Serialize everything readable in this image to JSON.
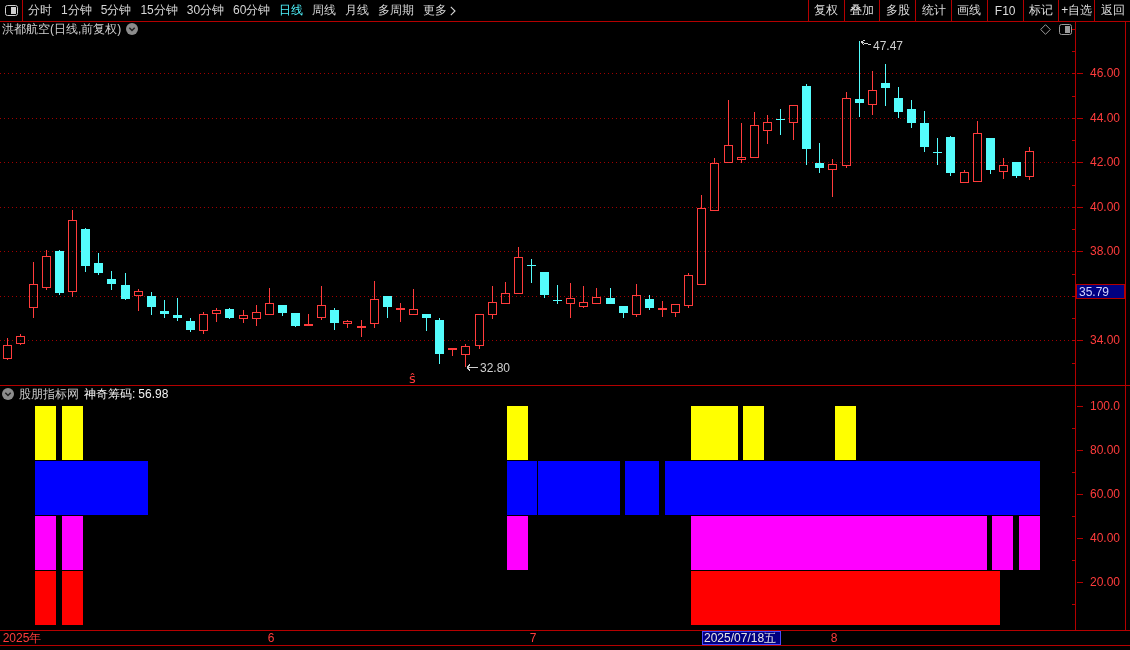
{
  "toolbar": {
    "periods": [
      {
        "label": "分时",
        "selected": false
      },
      {
        "label": "1分钟",
        "selected": false
      },
      {
        "label": "5分钟",
        "selected": false
      },
      {
        "label": "15分钟",
        "selected": false
      },
      {
        "label": "30分钟",
        "selected": false
      },
      {
        "label": "60分钟",
        "selected": false
      },
      {
        "label": "日线",
        "selected": true
      },
      {
        "label": "周线",
        "selected": false
      },
      {
        "label": "月线",
        "selected": false
      },
      {
        "label": "多周期",
        "selected": false
      },
      {
        "label": "更多",
        "selected": false
      }
    ],
    "actions": [
      "复权",
      "叠加",
      "多股",
      "统计",
      "画线",
      "F10",
      "标记",
      "+自选",
      "返回"
    ]
  },
  "price_pane": {
    "title": "洪都航空(日线,前复权)",
    "price_tag": "35.79",
    "signal_mark": "ŝ",
    "chart_data": [
      {
        "type": "candlestick",
        "ylim": [
          32,
          48.31
        ],
        "yticks": [
          {
            "value": 34,
            "label": "34.00"
          },
          {
            "value": 38,
            "label": "38.00"
          },
          {
            "value": 40,
            "label": "40.00"
          },
          {
            "value": 42,
            "label": "42.00"
          },
          {
            "value": 44,
            "label": "44.00"
          },
          {
            "value": 46,
            "label": "46.00"
          }
        ],
        "tick_labels": "y",
        "grid": true,
        "annotations": [
          "47.47",
          "32.80"
        ],
        "categories": [
          null,
          null,
          null,
          null,
          null,
          null,
          null,
          null,
          null,
          null,
          null,
          null,
          null,
          null,
          null,
          null,
          null,
          null,
          null,
          null,
          null,
          null,
          null,
          null,
          null,
          null,
          null,
          null,
          null,
          null,
          null,
          null,
          null,
          null,
          null,
          null,
          null,
          null,
          null,
          null,
          null,
          null,
          null,
          null,
          null,
          null,
          null,
          null,
          null,
          null,
          null,
          null,
          null,
          null,
          null,
          null,
          null,
          null,
          null,
          null,
          null,
          null,
          null,
          null,
          null,
          null,
          null,
          null,
          null,
          null,
          null,
          null,
          null,
          null,
          null,
          null,
          null,
          null,
          null,
          null,
          null,
          null
        ],
        "ohlc": [
          [
            33.22,
            34.11,
            33.13,
            33.8
          ],
          [
            33.89,
            34.3,
            33.8,
            34.2
          ],
          [
            35.51,
            37.53,
            35.01,
            36.54
          ],
          [
            36.41,
            38.07,
            36.27,
            37.8
          ],
          [
            38.03,
            38.07,
            36.05,
            36.14
          ],
          [
            36.23,
            39.87,
            35.96,
            39.42
          ],
          [
            39.02,
            39.06,
            37.08,
            37.35
          ],
          [
            37.49,
            37.94,
            36.95,
            37.04
          ],
          [
            36.77,
            37.13,
            36.27,
            36.54
          ],
          [
            36.5,
            37.04,
            35.82,
            35.87
          ],
          [
            36.05,
            36.32,
            35.33,
            36.23
          ],
          [
            36.0,
            36.18,
            35.15,
            35.51
          ],
          [
            35.33,
            35.82,
            35.01,
            35.19
          ],
          [
            35.15,
            35.91,
            34.88,
            35.01
          ],
          [
            34.88,
            35.01,
            34.38,
            34.47
          ],
          [
            34.47,
            35.28,
            34.29,
            35.19
          ],
          [
            35.24,
            35.46,
            34.83,
            35.37
          ],
          [
            35.42,
            35.46,
            34.97,
            35.01
          ],
          [
            35.01,
            35.37,
            34.79,
            35.15
          ],
          [
            35.01,
            35.6,
            34.65,
            35.28
          ],
          [
            35.19,
            36.36,
            35.19,
            35.69
          ],
          [
            35.6,
            35.6,
            35.1,
            35.24
          ],
          [
            35.24,
            35.24,
            34.61,
            34.65
          ],
          [
            34.74,
            35.19,
            34.74,
            34.76
          ],
          [
            35.06,
            36.45,
            34.92,
            35.6
          ],
          [
            35.37,
            35.46,
            34.47,
            34.79
          ],
          [
            34.79,
            34.92,
            34.56,
            34.88
          ],
          [
            34.61,
            34.92,
            34.16,
            34.65
          ],
          [
            34.79,
            36.68,
            34.56,
            35.87
          ],
          [
            36.0,
            36.0,
            35.01,
            35.51
          ],
          [
            35.46,
            35.69,
            34.83,
            35.48
          ],
          [
            35.19,
            36.32,
            35.19,
            35.42
          ],
          [
            35.19,
            35.19,
            34.43,
            35.01
          ],
          [
            34.92,
            35.01,
            32.95,
            33.4
          ],
          [
            33.62,
            33.66,
            33.3,
            33.66
          ],
          [
            33.4,
            33.84,
            32.8,
            33.75
          ],
          [
            33.8,
            35.19,
            33.62,
            35.19
          ],
          [
            35.19,
            36.45,
            34.97,
            35.73
          ],
          [
            35.69,
            36.63,
            35.69,
            36.14
          ],
          [
            36.14,
            38.21,
            36.14,
            37.76
          ],
          [
            37.4,
            37.67,
            36.59,
            37.35
          ],
          [
            37.08,
            37.08,
            35.91,
            36.05
          ],
          [
            35.82,
            36.5,
            35.64,
            35.78
          ],
          [
            35.69,
            36.59,
            35.01,
            35.91
          ],
          [
            35.55,
            36.45,
            35.46,
            35.73
          ],
          [
            35.69,
            36.36,
            35.69,
            35.96
          ],
          [
            35.91,
            36.36,
            35.64,
            35.64
          ],
          [
            35.55,
            35.55,
            35.01,
            35.24
          ],
          [
            35.19,
            36.54,
            35.06,
            36.05
          ],
          [
            35.87,
            36.05,
            35.37,
            35.46
          ],
          [
            35.46,
            35.78,
            35.06,
            35.48
          ],
          [
            35.28,
            35.64,
            35.06,
            35.64
          ],
          [
            35.6,
            37.04,
            35.46,
            36.95
          ],
          [
            36.54,
            40.55,
            36.5,
            39.96
          ],
          [
            39.87,
            42.21,
            39.87,
            41.99
          ],
          [
            42.03,
            44.82,
            41.99,
            42.8
          ],
          [
            42.17,
            43.79,
            41.99,
            42.26
          ],
          [
            42.26,
            44.28,
            42.26,
            43.7
          ],
          [
            43.47,
            44.15,
            42.84,
            43.83
          ],
          [
            43.97,
            44.42,
            43.25,
            43.92
          ],
          [
            43.83,
            44.6,
            43.02,
            44.6
          ],
          [
            45.45,
            45.54,
            41.9,
            42.62
          ],
          [
            41.99,
            42.89,
            41.54,
            41.76
          ],
          [
            41.72,
            42.17,
            40.46,
            41.94
          ],
          [
            41.9,
            45.18,
            41.76,
            44.91
          ],
          [
            44.87,
            47.47,
            44.06,
            44.69
          ],
          [
            44.64,
            46.13,
            44.15,
            45.27
          ],
          [
            45.59,
            46.44,
            44.55,
            45.36
          ],
          [
            44.91,
            45.41,
            44.01,
            44.28
          ],
          [
            44.42,
            44.82,
            43.56,
            43.79
          ],
          [
            43.79,
            44.33,
            42.48,
            42.71
          ],
          [
            42.48,
            43.11,
            41.9,
            42.44
          ],
          [
            43.16,
            43.2,
            41.4,
            41.54
          ],
          [
            41.13,
            41.67,
            41.09,
            41.58
          ],
          [
            41.18,
            43.88,
            41.18,
            43.34
          ],
          [
            43.11,
            43.11,
            41.49,
            41.67
          ],
          [
            41.63,
            42.21,
            41.27,
            41.9
          ],
          [
            42.03,
            42.03,
            41.31,
            41.4
          ],
          [
            41.4,
            42.71,
            41.22,
            42.53
          ],
          null,
          null,
          null
        ]
      }
    ]
  },
  "indicator_pane": {
    "source": "股朋指标网",
    "label": "神奇筹码:",
    "value": "56.98",
    "cursor_date": "2025/07/18五",
    "chart_data": [
      {
        "type": "bar",
        "ylim": [
          -1.8,
          109.7
        ],
        "yticks": [
          {
            "value": 20,
            "label": "20.00"
          },
          {
            "value": 40,
            "label": "40.00"
          },
          {
            "value": 60,
            "label": "60.00"
          },
          {
            "value": 80,
            "label": "80.00"
          },
          {
            "value": 100,
            "label": "100.0"
          }
        ],
        "categories": [
          null,
          "2025年",
          null,
          null,
          null,
          null,
          null,
          null,
          null,
          null,
          null,
          null,
          null,
          null,
          null,
          null,
          null,
          null,
          null,
          null,
          "6",
          null,
          null,
          null,
          null,
          null,
          null,
          null,
          null,
          null,
          null,
          null,
          null,
          null,
          null,
          null,
          null,
          null,
          null,
          null,
          "7",
          null,
          null,
          null,
          null,
          null,
          null,
          null,
          null,
          null,
          null,
          null,
          null,
          null,
          null,
          null,
          null,
          null,
          null,
          null,
          null,
          null,
          null,
          "8",
          null,
          null,
          null,
          null,
          null,
          null,
          null,
          null,
          null,
          null,
          null,
          null,
          null,
          null,
          null,
          null,
          null,
          null
        ],
        "series": [
          {
            "color": "#ffff00",
            "values": [
              null,
              null,
              null,
              25,
              null,
              25,
              null,
              null,
              null,
              null,
              null,
              null,
              null,
              null,
              null,
              null,
              null,
              null,
              null,
              null,
              null,
              null,
              null,
              null,
              null,
              null,
              null,
              null,
              null,
              null,
              null,
              null,
              null,
              null,
              null,
              null,
              null,
              null,
              null,
              25,
              null,
              null,
              null,
              null,
              null,
              null,
              null,
              null,
              null,
              null,
              null,
              null,
              null,
              25,
              25,
              25,
              null,
              25,
              null,
              null,
              null,
              null,
              null,
              null,
              25,
              null,
              null,
              null,
              null,
              null,
              null,
              null,
              null,
              null,
              null,
              null,
              null,
              null,
              null,
              null,
              null,
              null
            ],
            "base": [
              null,
              null,
              null,
              75,
              null,
              75,
              null,
              null,
              null,
              null,
              null,
              null,
              null,
              null,
              null,
              null,
              null,
              null,
              null,
              null,
              null,
              null,
              null,
              null,
              null,
              null,
              null,
              null,
              null,
              null,
              null,
              null,
              null,
              null,
              null,
              null,
              null,
              null,
              null,
              75,
              null,
              null,
              null,
              null,
              null,
              null,
              null,
              null,
              null,
              null,
              null,
              null,
              null,
              75,
              75,
              75,
              null,
              75,
              null,
              null,
              null,
              null,
              null,
              null,
              75,
              null,
              null,
              null,
              null,
              null,
              null,
              null,
              null,
              null,
              null,
              null,
              null,
              null,
              null,
              null,
              null,
              null
            ]
          },
          {
            "color": "#0000ff",
            "values": [
              null,
              null,
              null,
              25,
              25,
              25,
              25,
              25,
              25,
              25,
              25,
              null,
              null,
              null,
              null,
              null,
              null,
              null,
              null,
              null,
              null,
              null,
              null,
              null,
              null,
              null,
              null,
              null,
              null,
              null,
              null,
              null,
              null,
              null,
              null,
              null,
              null,
              null,
              null,
              25,
              25,
              25,
              25,
              25,
              25,
              25,
              25,
              null,
              25,
              25,
              null,
              25,
              25,
              25,
              25,
              25,
              25,
              25,
              25,
              25,
              25,
              25,
              25,
              25,
              25,
              25,
              25,
              25,
              25,
              25,
              25,
              25,
              25,
              25,
              25,
              25,
              25,
              25,
              25,
              null,
              null,
              null
            ],
            "base": [
              null,
              null,
              null,
              50,
              50,
              50,
              50,
              50,
              50,
              50,
              50,
              null,
              null,
              null,
              null,
              null,
              null,
              null,
              null,
              null,
              null,
              null,
              null,
              null,
              null,
              null,
              null,
              null,
              null,
              null,
              null,
              null,
              null,
              null,
              null,
              null,
              null,
              null,
              null,
              50,
              50,
              50,
              50,
              50,
              50,
              50,
              50,
              null,
              50,
              50,
              null,
              50,
              50,
              50,
              50,
              50,
              50,
              50,
              50,
              50,
              50,
              50,
              50,
              50,
              50,
              50,
              50,
              50,
              50,
              50,
              50,
              50,
              50,
              50,
              50,
              50,
              50,
              50,
              50,
              null,
              null,
              null
            ]
          },
          {
            "color": "#ff00ff",
            "values": [
              null,
              null,
              null,
              25,
              null,
              25,
              null,
              null,
              null,
              null,
              null,
              null,
              null,
              null,
              null,
              null,
              null,
              null,
              null,
              null,
              null,
              null,
              null,
              null,
              null,
              null,
              null,
              null,
              null,
              null,
              null,
              null,
              null,
              null,
              null,
              null,
              null,
              null,
              null,
              25,
              null,
              null,
              null,
              null,
              null,
              null,
              null,
              null,
              null,
              null,
              null,
              null,
              null,
              25,
              25,
              25,
              25,
              25,
              25,
              25,
              25,
              25,
              25,
              25,
              25,
              25,
              25,
              25,
              25,
              25,
              25,
              25,
              25,
              25,
              25,
              null,
              25,
              null,
              25,
              null,
              null,
              null
            ],
            "base": [
              null,
              null,
              null,
              25,
              null,
              25,
              null,
              null,
              null,
              null,
              null,
              null,
              null,
              null,
              null,
              null,
              null,
              null,
              null,
              null,
              null,
              null,
              null,
              null,
              null,
              null,
              null,
              null,
              null,
              null,
              null,
              null,
              null,
              null,
              null,
              null,
              null,
              null,
              null,
              25,
              null,
              null,
              null,
              null,
              null,
              null,
              null,
              null,
              null,
              null,
              null,
              null,
              null,
              25,
              25,
              25,
              25,
              25,
              25,
              25,
              25,
              25,
              25,
              25,
              25,
              25,
              25,
              25,
              25,
              25,
              25,
              25,
              25,
              25,
              25,
              null,
              25,
              null,
              25,
              null,
              null,
              null
            ]
          },
          {
            "color": "#ff0000",
            "values": [
              null,
              null,
              null,
              25,
              null,
              25,
              null,
              null,
              null,
              null,
              null,
              null,
              null,
              null,
              null,
              null,
              null,
              null,
              null,
              null,
              null,
              null,
              null,
              null,
              null,
              null,
              null,
              null,
              null,
              null,
              null,
              null,
              null,
              null,
              null,
              null,
              null,
              null,
              null,
              null,
              null,
              null,
              null,
              null,
              null,
              null,
              null,
              null,
              null,
              null,
              null,
              null,
              null,
              25,
              25,
              25,
              25,
              25,
              25,
              25,
              25,
              25,
              25,
              25,
              25,
              25,
              25,
              25,
              25,
              25,
              25,
              25,
              25,
              25,
              25,
              25,
              null,
              null,
              null,
              null,
              null,
              null
            ],
            "base": [
              null,
              null,
              null,
              0,
              null,
              0,
              null,
              null,
              null,
              null,
              null,
              null,
              null,
              null,
              null,
              null,
              null,
              null,
              null,
              null,
              null,
              null,
              null,
              null,
              null,
              null,
              null,
              null,
              null,
              null,
              null,
              null,
              null,
              null,
              null,
              null,
              null,
              null,
              null,
              null,
              null,
              null,
              null,
              null,
              null,
              null,
              null,
              null,
              null,
              null,
              null,
              null,
              null,
              0,
              0,
              0,
              0,
              0,
              0,
              0,
              0,
              0,
              0,
              0,
              0,
              0,
              0,
              0,
              0,
              0,
              0,
              0,
              0,
              0,
              0,
              0,
              null,
              null,
              null,
              null,
              null,
              null
            ]
          }
        ]
      }
    ]
  }
}
